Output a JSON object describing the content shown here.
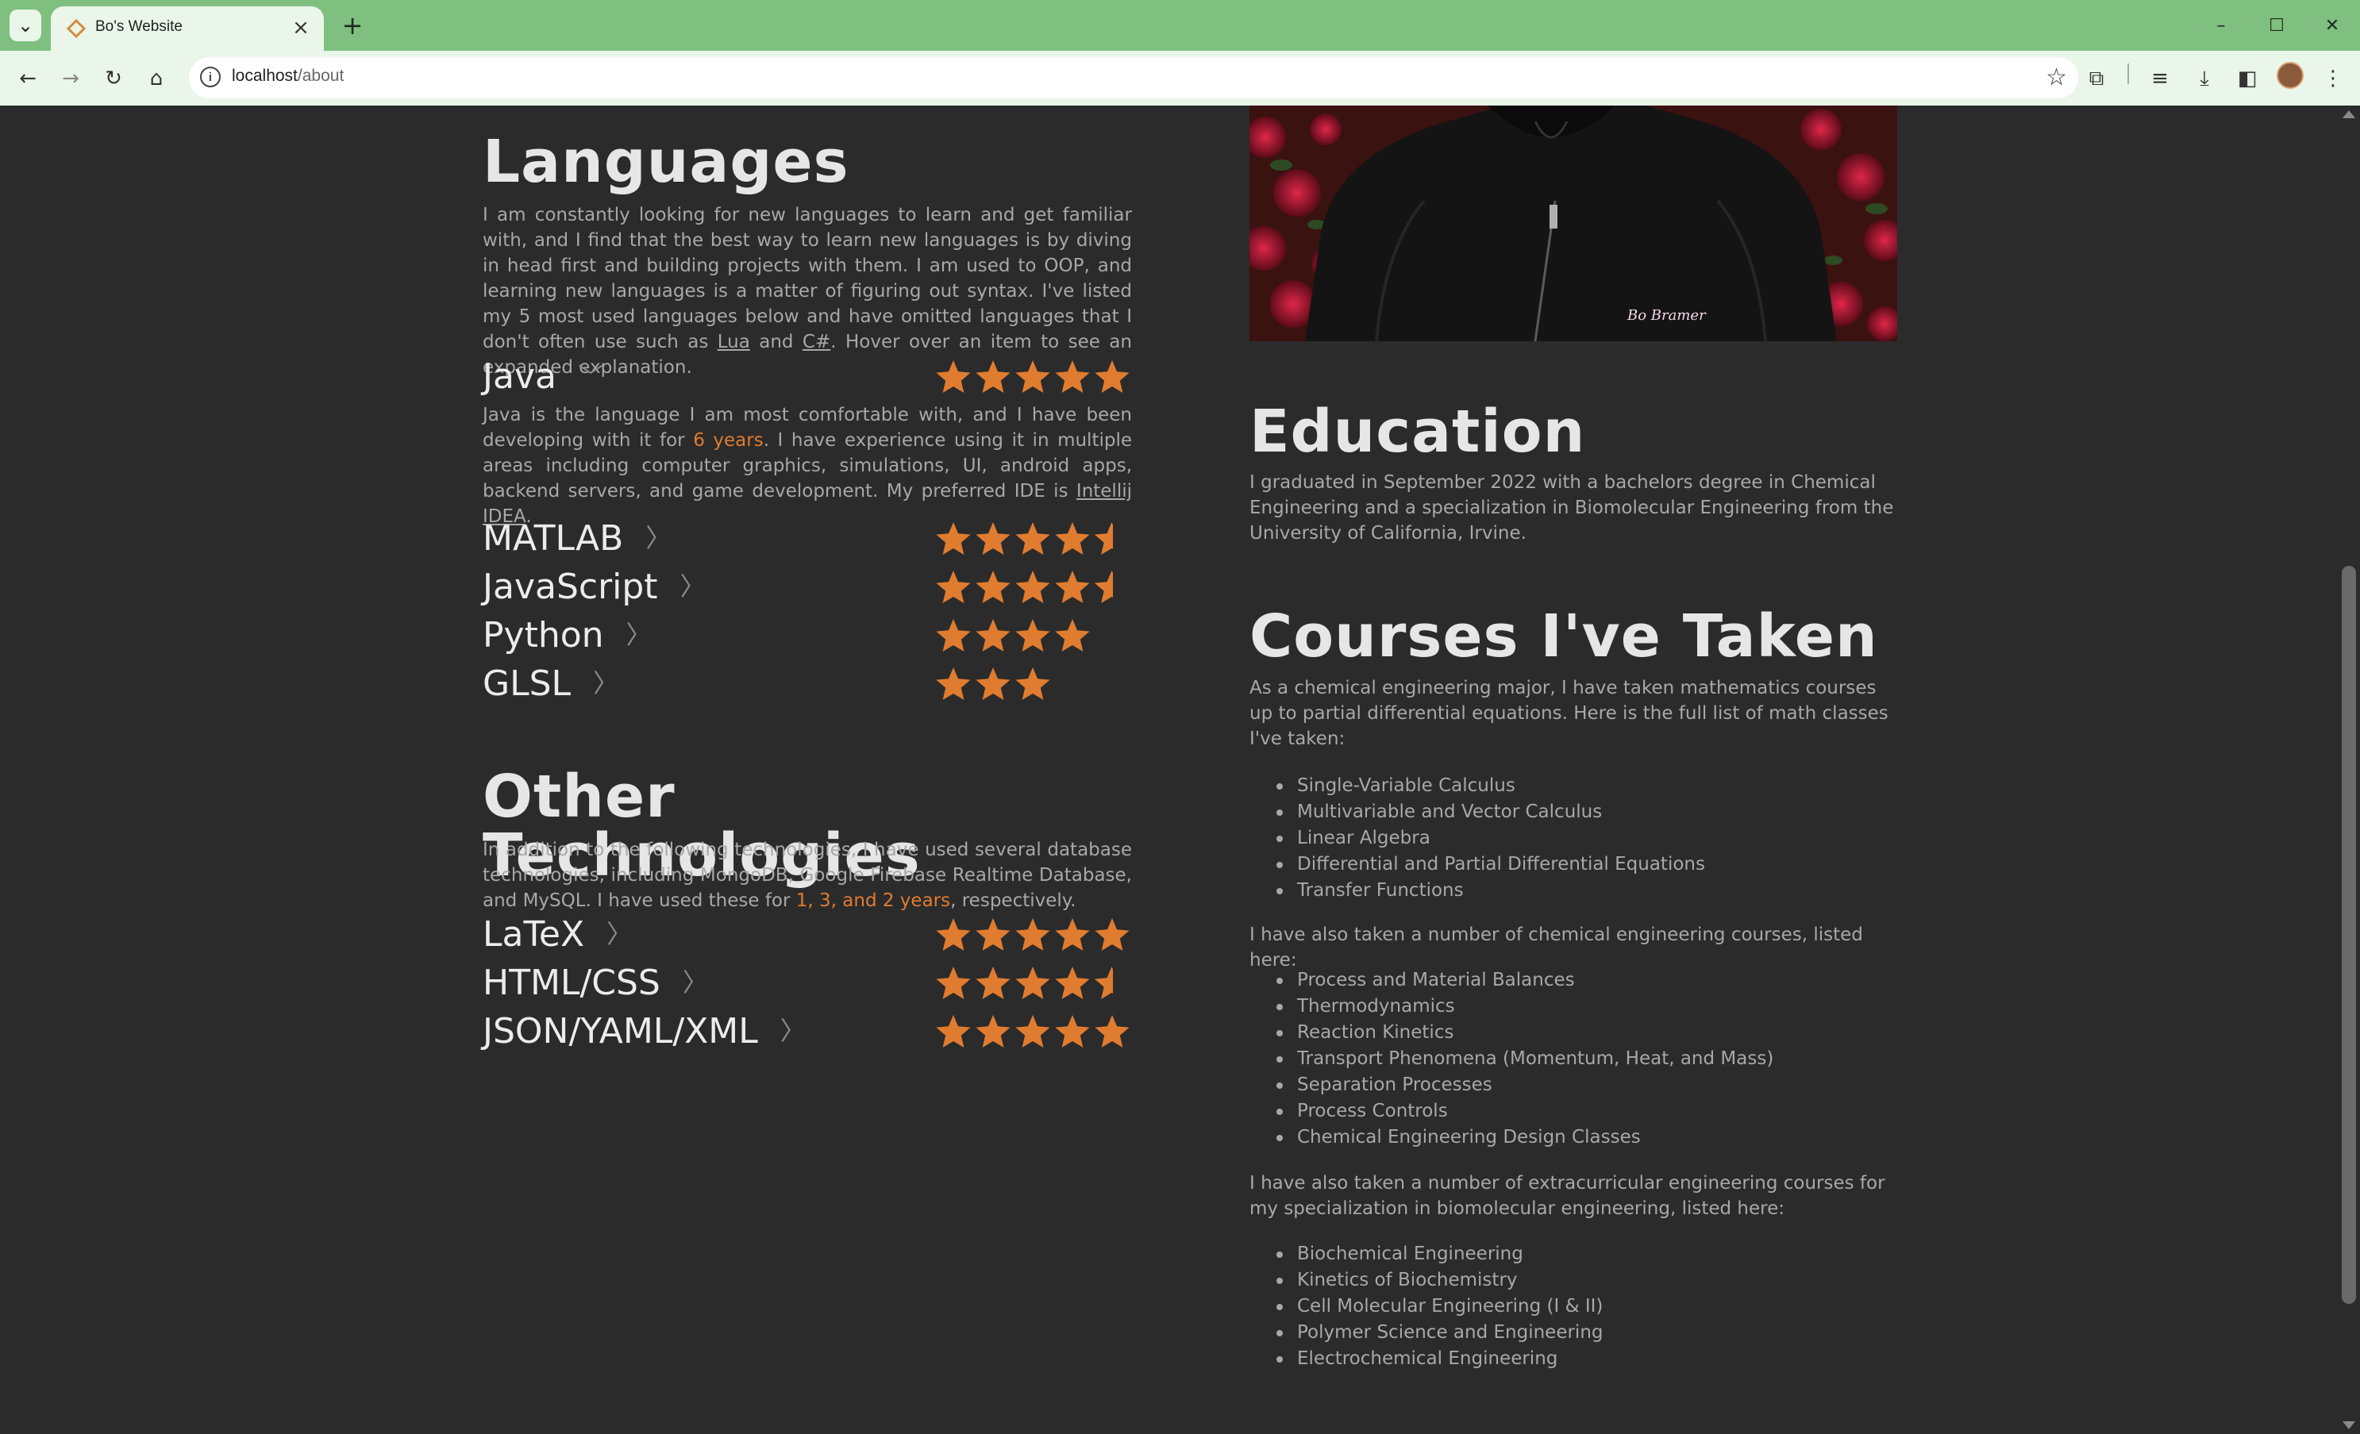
{
  "browser": {
    "tab_title": "Bo's Website",
    "url_host": "localhost",
    "url_path": "/about",
    "new_tab": "+",
    "close": "×"
  },
  "languages": {
    "heading": "Languages",
    "intro_1": "I am constantly looking for new languages to learn and get familiar with, and I find that the best way to learn new languages is by diving in head first and building projects with them. I am used to OOP, and learning new languages is a matter of figuring out syntax. I've listed my 5 most used languages below and have omitted languages that I don't often use such as ",
    "link_lua": "Lua",
    "and": " and ",
    "link_csharp": "C#",
    "intro_2": ". Hover over an item to see an expanded explanation.",
    "java": {
      "name": "Java",
      "rating": 5,
      "desc_1": "Java is the language I am most comfortable with, and I have been developing with it for ",
      "highlight": "6 years",
      "desc_2": ". I have experience using it in multiple areas including computer graphics, simulations, UI, android apps, backend servers, and game development. My preferred IDE is ",
      "link_ide": "Intellij IDEA",
      "desc_3": "."
    },
    "items": [
      {
        "name": "MATLAB",
        "rating": 4.5
      },
      {
        "name": "JavaScript",
        "rating": 4.5
      },
      {
        "name": "Python",
        "rating": 4
      },
      {
        "name": "GLSL",
        "rating": 3
      }
    ]
  },
  "other": {
    "heading": "Other Technologies",
    "intro_1": "In addition to the following technologies, I have used several database technologies, including MongoDB, Google Firebase Realtime Database, and MySQL. I have used these for ",
    "highlight": "1, 3, and 2 years",
    "intro_2": ", respectively.",
    "items": [
      {
        "name": "LaTeX",
        "rating": 5
      },
      {
        "name": "HTML/CSS",
        "rating": 4.5
      },
      {
        "name": "JSON/YAML/XML",
        "rating": 5
      }
    ]
  },
  "photo": {
    "caption": "Bo Bramer"
  },
  "education": {
    "heading": "Education",
    "text": "I graduated in September 2022 with a bachelors degree in Chemical Engineering and a specialization in Biomolecular Engineering from the University of California, Irvine."
  },
  "courses": {
    "heading": "Courses I've Taken",
    "math_intro": "As a chemical engineering major, I have taken mathematics courses up to partial differential equations. Here is the full list of math classes I've taken:",
    "math": [
      "Single-Variable Calculus",
      "Multivariable and Vector Calculus",
      "Linear Algebra",
      "Differential and Partial Differential Equations",
      "Transfer Functions"
    ],
    "chem_intro": "I have also taken a number of chemical engineering courses, listed here:",
    "chem": [
      "Process and Material Balances",
      "Thermodynamics",
      "Reaction Kinetics",
      "Transport Phenomena (Momentum, Heat, and Mass)",
      "Separation Processes",
      "Process Controls",
      "Chemical Engineering Design Classes"
    ],
    "bio_intro": "I have also taken a number of extracurricular engineering courses for my specialization in biomolecular engineering, listed here:",
    "bio": [
      "Biochemical Engineering",
      "Kinetics of Biochemistry",
      "Cell Molecular Engineering (I & II)",
      "Polymer Science and Engineering",
      "Electrochemical Engineering"
    ]
  },
  "colors": {
    "accent": "#e07c30",
    "star": "#e07c30",
    "chrome": "#7fbf7f",
    "background": "#2b2b2b"
  }
}
